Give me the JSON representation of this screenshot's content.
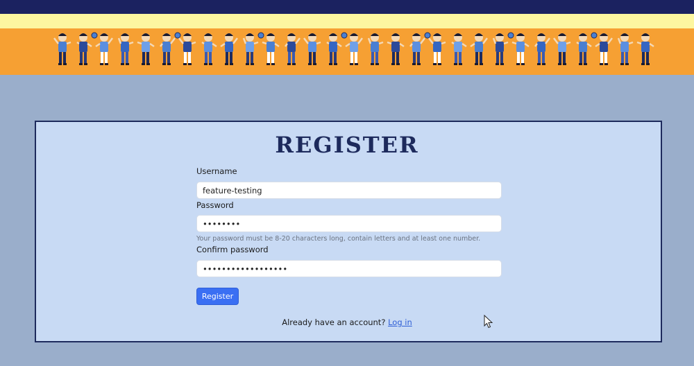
{
  "form": {
    "title": "REGISTER",
    "username_label": "Username",
    "username_value": "feature-testing",
    "password_label": "Password",
    "password_value": "••••••••",
    "password_help": "Your password must be 8-20 characters long, contain letters and at least one number.",
    "confirm_label": "Confirm password",
    "confirm_value": "••••••••••••••••••",
    "submit_label": "Register"
  },
  "footer": {
    "prompt": "Already have an account?",
    "login_link": "Log in"
  },
  "colors": {
    "header": "#1b2260",
    "stripe": "#fdf6a0",
    "banner": "#f6a033",
    "page_bg": "#9aaecb",
    "panel_bg": "#c8daf4",
    "accent": "#3a6ff3"
  },
  "icons": {
    "banner": "kids-illustration",
    "pointer": "mouse-cursor-icon"
  }
}
